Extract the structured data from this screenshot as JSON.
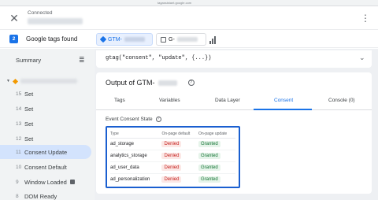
{
  "browser": {
    "url": "tagassistant.google.com"
  },
  "header": {
    "connected_label": "Connected"
  },
  "tagsbar": {
    "count": "2",
    "label": "Google tags found",
    "chips": [
      {
        "prefix": "GTM-"
      },
      {
        "prefix": "G-"
      }
    ]
  },
  "sidebar": {
    "summary": "Summary",
    "items": [
      {
        "num": "15",
        "label": "Set"
      },
      {
        "num": "14",
        "label": "Set"
      },
      {
        "num": "13",
        "label": "Set"
      },
      {
        "num": "12",
        "label": "Set"
      },
      {
        "num": "11",
        "label": "Consent Update",
        "active": true
      },
      {
        "num": "10",
        "label": "Consent Default"
      },
      {
        "num": "9",
        "label": "Window Loaded"
      },
      {
        "num": "8",
        "label": "DOM Ready"
      }
    ]
  },
  "main": {
    "code": "gtag(\"consent\", \"update\", {...})",
    "output_title": "Output of GTM-",
    "tabs": [
      "Tags",
      "Variables",
      "Data Layer",
      "Consent",
      "Console (0)"
    ],
    "active_tab": "Consent",
    "section_label": "Event Consent State",
    "table": {
      "headers": [
        "Type",
        "On-page default",
        "On-page update"
      ],
      "rows": [
        {
          "type": "ad_storage",
          "default": "Denied",
          "update": "Granted"
        },
        {
          "type": "analytics_storage",
          "default": "Denied",
          "update": "Granted"
        },
        {
          "type": "ad_user_data",
          "default": "Denied",
          "update": "Granted"
        },
        {
          "type": "ad_personalization",
          "default": "Denied",
          "update": "Granted"
        }
      ]
    }
  },
  "colors": {
    "accent": "#1a73e8",
    "denied": "#c5221f",
    "granted": "#137333",
    "active_bg": "#d3e3fd"
  }
}
